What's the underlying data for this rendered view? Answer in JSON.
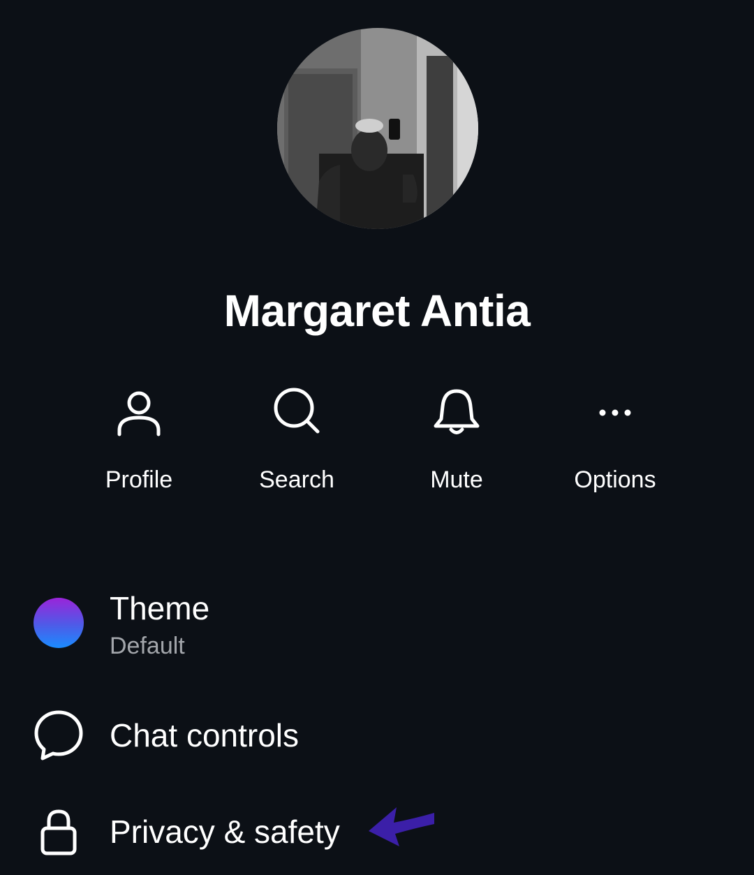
{
  "profile": {
    "name": "Margaret Antia",
    "avatar_description": "photo"
  },
  "actions": [
    {
      "label": "Profile",
      "icon": "person-icon"
    },
    {
      "label": "Search",
      "icon": "search-icon"
    },
    {
      "label": "Mute",
      "icon": "bell-icon"
    },
    {
      "label": "Options",
      "icon": "more-horizontal-icon"
    }
  ],
  "settings": {
    "theme": {
      "title": "Theme",
      "value": "Default",
      "icon": "theme-color-dot"
    },
    "chat_controls": {
      "title": "Chat controls",
      "icon": "chat-bubble-icon"
    },
    "privacy": {
      "title": "Privacy & safety",
      "icon": "lock-icon"
    }
  },
  "annotation": {
    "icon": "pointer-arrow-icon",
    "color": "#3b1fa8"
  },
  "colors": {
    "background": "#0c1016",
    "text": "#ffffff",
    "secondary_text": "#a3a6ab",
    "theme_gradient": [
      "#9a24d9",
      "#1a8cff"
    ]
  }
}
